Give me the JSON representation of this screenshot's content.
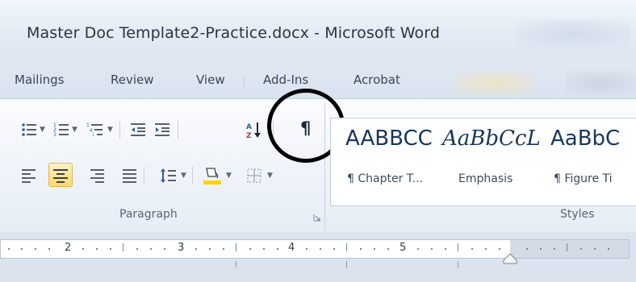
{
  "window": {
    "title": "Master Doc Template2-Practice.docx - Microsoft Word"
  },
  "tabs": [
    {
      "label": "Mailings"
    },
    {
      "label": "Review"
    },
    {
      "label": "View"
    },
    {
      "label": "Add-Ins"
    },
    {
      "label": "Acrobat"
    }
  ],
  "paragraph_group": {
    "label": "Paragraph",
    "buttons": [
      {
        "name": "Bullets"
      },
      {
        "name": "Numbering"
      },
      {
        "name": "Multilevel List"
      },
      {
        "name": "Decrease Indent"
      },
      {
        "name": "Increase Indent"
      },
      {
        "name": "Sort"
      },
      {
        "name": "Show/Hide ¶",
        "glyph": "¶",
        "highlighted_by_circle": true
      },
      {
        "name": "Align Text Left"
      },
      {
        "name": "Center",
        "active": true
      },
      {
        "name": "Align Text Right"
      },
      {
        "name": "Justify"
      },
      {
        "name": "Line and Paragraph Spacing"
      },
      {
        "name": "Shading"
      },
      {
        "name": "Borders"
      }
    ]
  },
  "styles_group": {
    "label": "Styles",
    "items": [
      {
        "sample": "AABBCC",
        "name": "¶ Chapter T..."
      },
      {
        "sample": "AaBbCcL",
        "name": "Emphasis"
      },
      {
        "sample": "AaBbC",
        "name": "¶ Figure Ti"
      }
    ]
  },
  "ruler": {
    "numbers": [
      "2",
      "3",
      "4",
      "5"
    ]
  },
  "colors": {
    "annotation_circle": "#000000",
    "active_button": "#ffd76b",
    "ribbon_background": "#eef3f9",
    "style_text": "#17365d"
  }
}
